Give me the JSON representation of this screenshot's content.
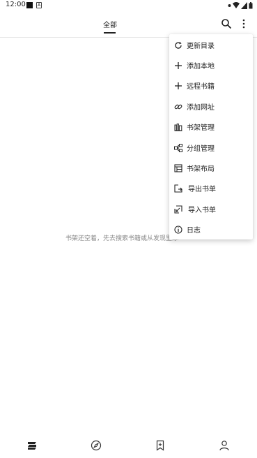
{
  "status_bar": {
    "time": "12:00",
    "notification_badge": "A"
  },
  "header": {
    "tab_label": "全部",
    "search_icon": "search-icon",
    "more_icon": "more-vert-icon"
  },
  "empty_state": {
    "message": "书架还空着，先去搜索书籍或从发现里添"
  },
  "menu": {
    "items": [
      {
        "label": "更新目录",
        "icon": "refresh-icon"
      },
      {
        "label": "添加本地",
        "icon": "plus-icon"
      },
      {
        "label": "远程书籍",
        "icon": "plus-icon"
      },
      {
        "label": "添加网址",
        "icon": "link-icon"
      },
      {
        "label": "书架管理",
        "icon": "bookshelf-icon"
      },
      {
        "label": "分组管理",
        "icon": "group-icon"
      },
      {
        "label": "书架布局",
        "icon": "layout-icon"
      },
      {
        "label": "导出书单",
        "icon": "export-icon"
      },
      {
        "label": "导入书单",
        "icon": "import-icon"
      },
      {
        "label": "日志",
        "icon": "info-icon"
      }
    ]
  },
  "bottom_nav": [
    {
      "name": "bookshelf",
      "icon": "bookshelf-nav-icon",
      "active": true
    },
    {
      "name": "discover",
      "icon": "compass-icon",
      "active": false
    },
    {
      "name": "rss",
      "icon": "bookmark-icon",
      "active": false
    },
    {
      "name": "my",
      "icon": "person-icon",
      "active": false
    }
  ],
  "colors": {
    "text": "#222222",
    "muted": "#8a8a8a",
    "divider": "#e6e6e6"
  }
}
